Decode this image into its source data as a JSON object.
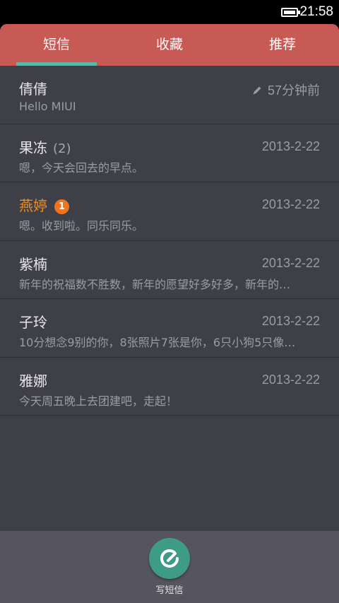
{
  "status_bar": {
    "time": "21:58"
  },
  "tabs": [
    {
      "label": "短信",
      "active": true
    },
    {
      "label": "收藏",
      "active": false
    },
    {
      "label": "推荐",
      "active": false
    }
  ],
  "conversations": [
    {
      "name": "倩倩",
      "count": "",
      "unread_badge": "",
      "time": "57分钟前",
      "draft": true,
      "preview": "Hello MIUI"
    },
    {
      "name": "果冻",
      "count": "(2)",
      "unread_badge": "",
      "time": "2013-2-22",
      "draft": false,
      "preview": "嗯，今天会回去的早点。"
    },
    {
      "name": "燕婷",
      "count": "",
      "unread_badge": "1",
      "time": "2013-2-22",
      "draft": false,
      "preview": "嗯。收到啦。同乐同乐。"
    },
    {
      "name": "紫楠",
      "count": "",
      "unread_badge": "",
      "time": "2013-2-22",
      "draft": false,
      "preview": "新年的祝福数不胜数，新年的愿望好多好多，新年的…"
    },
    {
      "name": "子玲",
      "count": "",
      "unread_badge": "",
      "time": "2013-2-22",
      "draft": false,
      "preview": "10分想念9别的你，8张照片7张是你，6只小狗5只像…"
    },
    {
      "name": "雅娜",
      "count": "",
      "unread_badge": "",
      "time": "2013-2-22",
      "draft": false,
      "preview": "今天周五晚上去团建吧，走起！"
    }
  ],
  "compose": {
    "label": "写短信"
  },
  "colors": {
    "tab_bar": "#c85a55",
    "tab_indicator": "#5bb6a5",
    "list_bg": "#3f3f47",
    "unread_name": "#f18d20",
    "compose_button": "#3e9b85"
  }
}
